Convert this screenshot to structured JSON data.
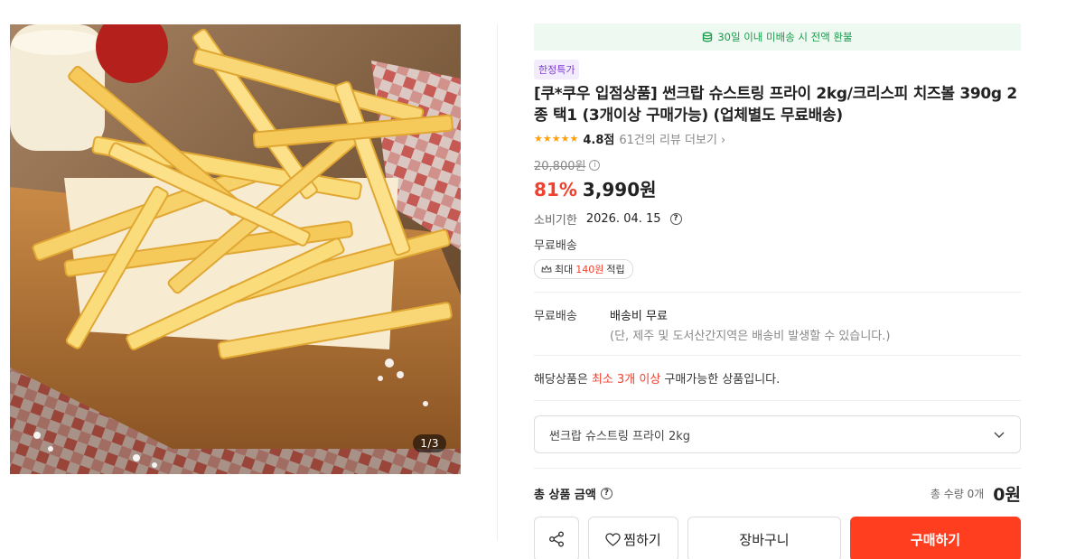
{
  "gallery": {
    "counter": "1/3"
  },
  "refund_banner": {
    "text": "30일 이내 미배송 시 전액 환불",
    "icon": "coin-stack-icon"
  },
  "product": {
    "badge": "한정특가",
    "title": "[쿠*쿠우 입점상품] 썬크랍 슈스트링 프라이 2kg/크리스피 치즈볼 390g 2종 택1 (3개이상 구매가능) (업체별도 무료배송)",
    "rating": {
      "stars": 5,
      "score": "4.8점",
      "reviews_link": "61건의 리뷰 더보기"
    },
    "original_price": "20,800원",
    "discount": "81%",
    "sale_price": "3,990원",
    "expiry": {
      "label": "소비기한",
      "value": "2026. 04. 15"
    },
    "free_shipping": "무료배송",
    "points": {
      "prefix": "최대 ",
      "amount": "140원",
      "suffix": " 적립"
    }
  },
  "shipping": {
    "label": "무료배송",
    "fee": "배송비 무료",
    "note": "(단, 제주 및 도서산간지역은 배송비 발생할 수 있습니다.)"
  },
  "min_purchase": {
    "prefix": "해당상품은 ",
    "highlight": "최소 3개 이상",
    "suffix": " 구매가능한 상품입니다."
  },
  "option": {
    "selected": "썬크랍 슈스트링 프라이 2kg"
  },
  "total": {
    "label": "총 상품 금액",
    "qty": "총 수량 0개",
    "amount": "0원"
  },
  "actions": {
    "wish": "찜하기",
    "cart": "장바구니",
    "buy": "구매하기"
  },
  "colors": {
    "accent_red": "#f0412e",
    "buy_button": "#ff3d1f",
    "banner_green": "#1a9c4c",
    "badge_purple": "#7c3ad6",
    "star": "#ff9f0a"
  }
}
